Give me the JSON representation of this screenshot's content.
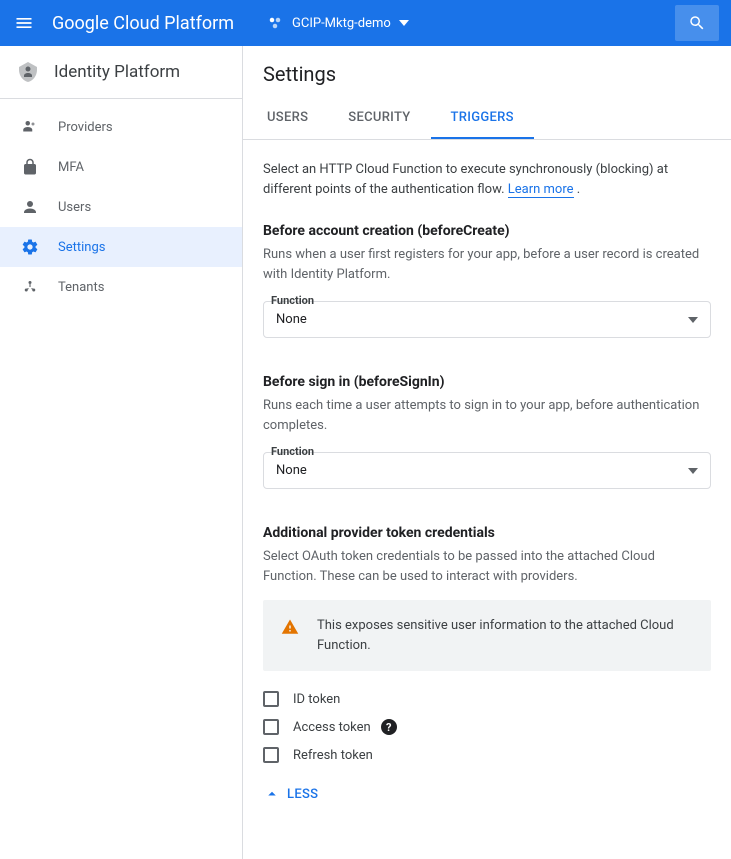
{
  "topbar": {
    "logo": "Google Cloud Platform",
    "project": "GCIP-Mktg-demo"
  },
  "sidebar": {
    "title": "Identity Platform",
    "items": [
      {
        "label": "Providers"
      },
      {
        "label": "MFA"
      },
      {
        "label": "Users"
      },
      {
        "label": "Settings"
      },
      {
        "label": "Tenants"
      }
    ]
  },
  "page": {
    "title": "Settings",
    "tabs": [
      {
        "label": "USERS"
      },
      {
        "label": "SECURITY"
      },
      {
        "label": "TRIGGERS"
      }
    ],
    "intro": "Select an HTTP Cloud Function to execute synchronously (blocking) at different points of the authentication flow.",
    "learn_more": "Learn more",
    "sections": {
      "beforeCreate": {
        "title": "Before account creation (beforeCreate)",
        "desc": "Runs when a user first registers for your app, before a user record is created with Identity Platform.",
        "select_label": "Function",
        "select_value": "None"
      },
      "beforeSignIn": {
        "title": "Before sign in (beforeSignIn)",
        "desc": "Runs each time a user attempts to sign in to your app, before authentication completes.",
        "select_label": "Function",
        "select_value": "None"
      },
      "tokens": {
        "title": "Additional provider token credentials",
        "desc": "Select OAuth token credentials to be passed into the attached Cloud Function. These can be used to interact with providers.",
        "warning": "This exposes sensitive user information to the attached Cloud Function.",
        "checkboxes": [
          {
            "label": "ID token"
          },
          {
            "label": "Access token"
          },
          {
            "label": "Refresh token"
          }
        ]
      }
    },
    "less": "LESS"
  }
}
